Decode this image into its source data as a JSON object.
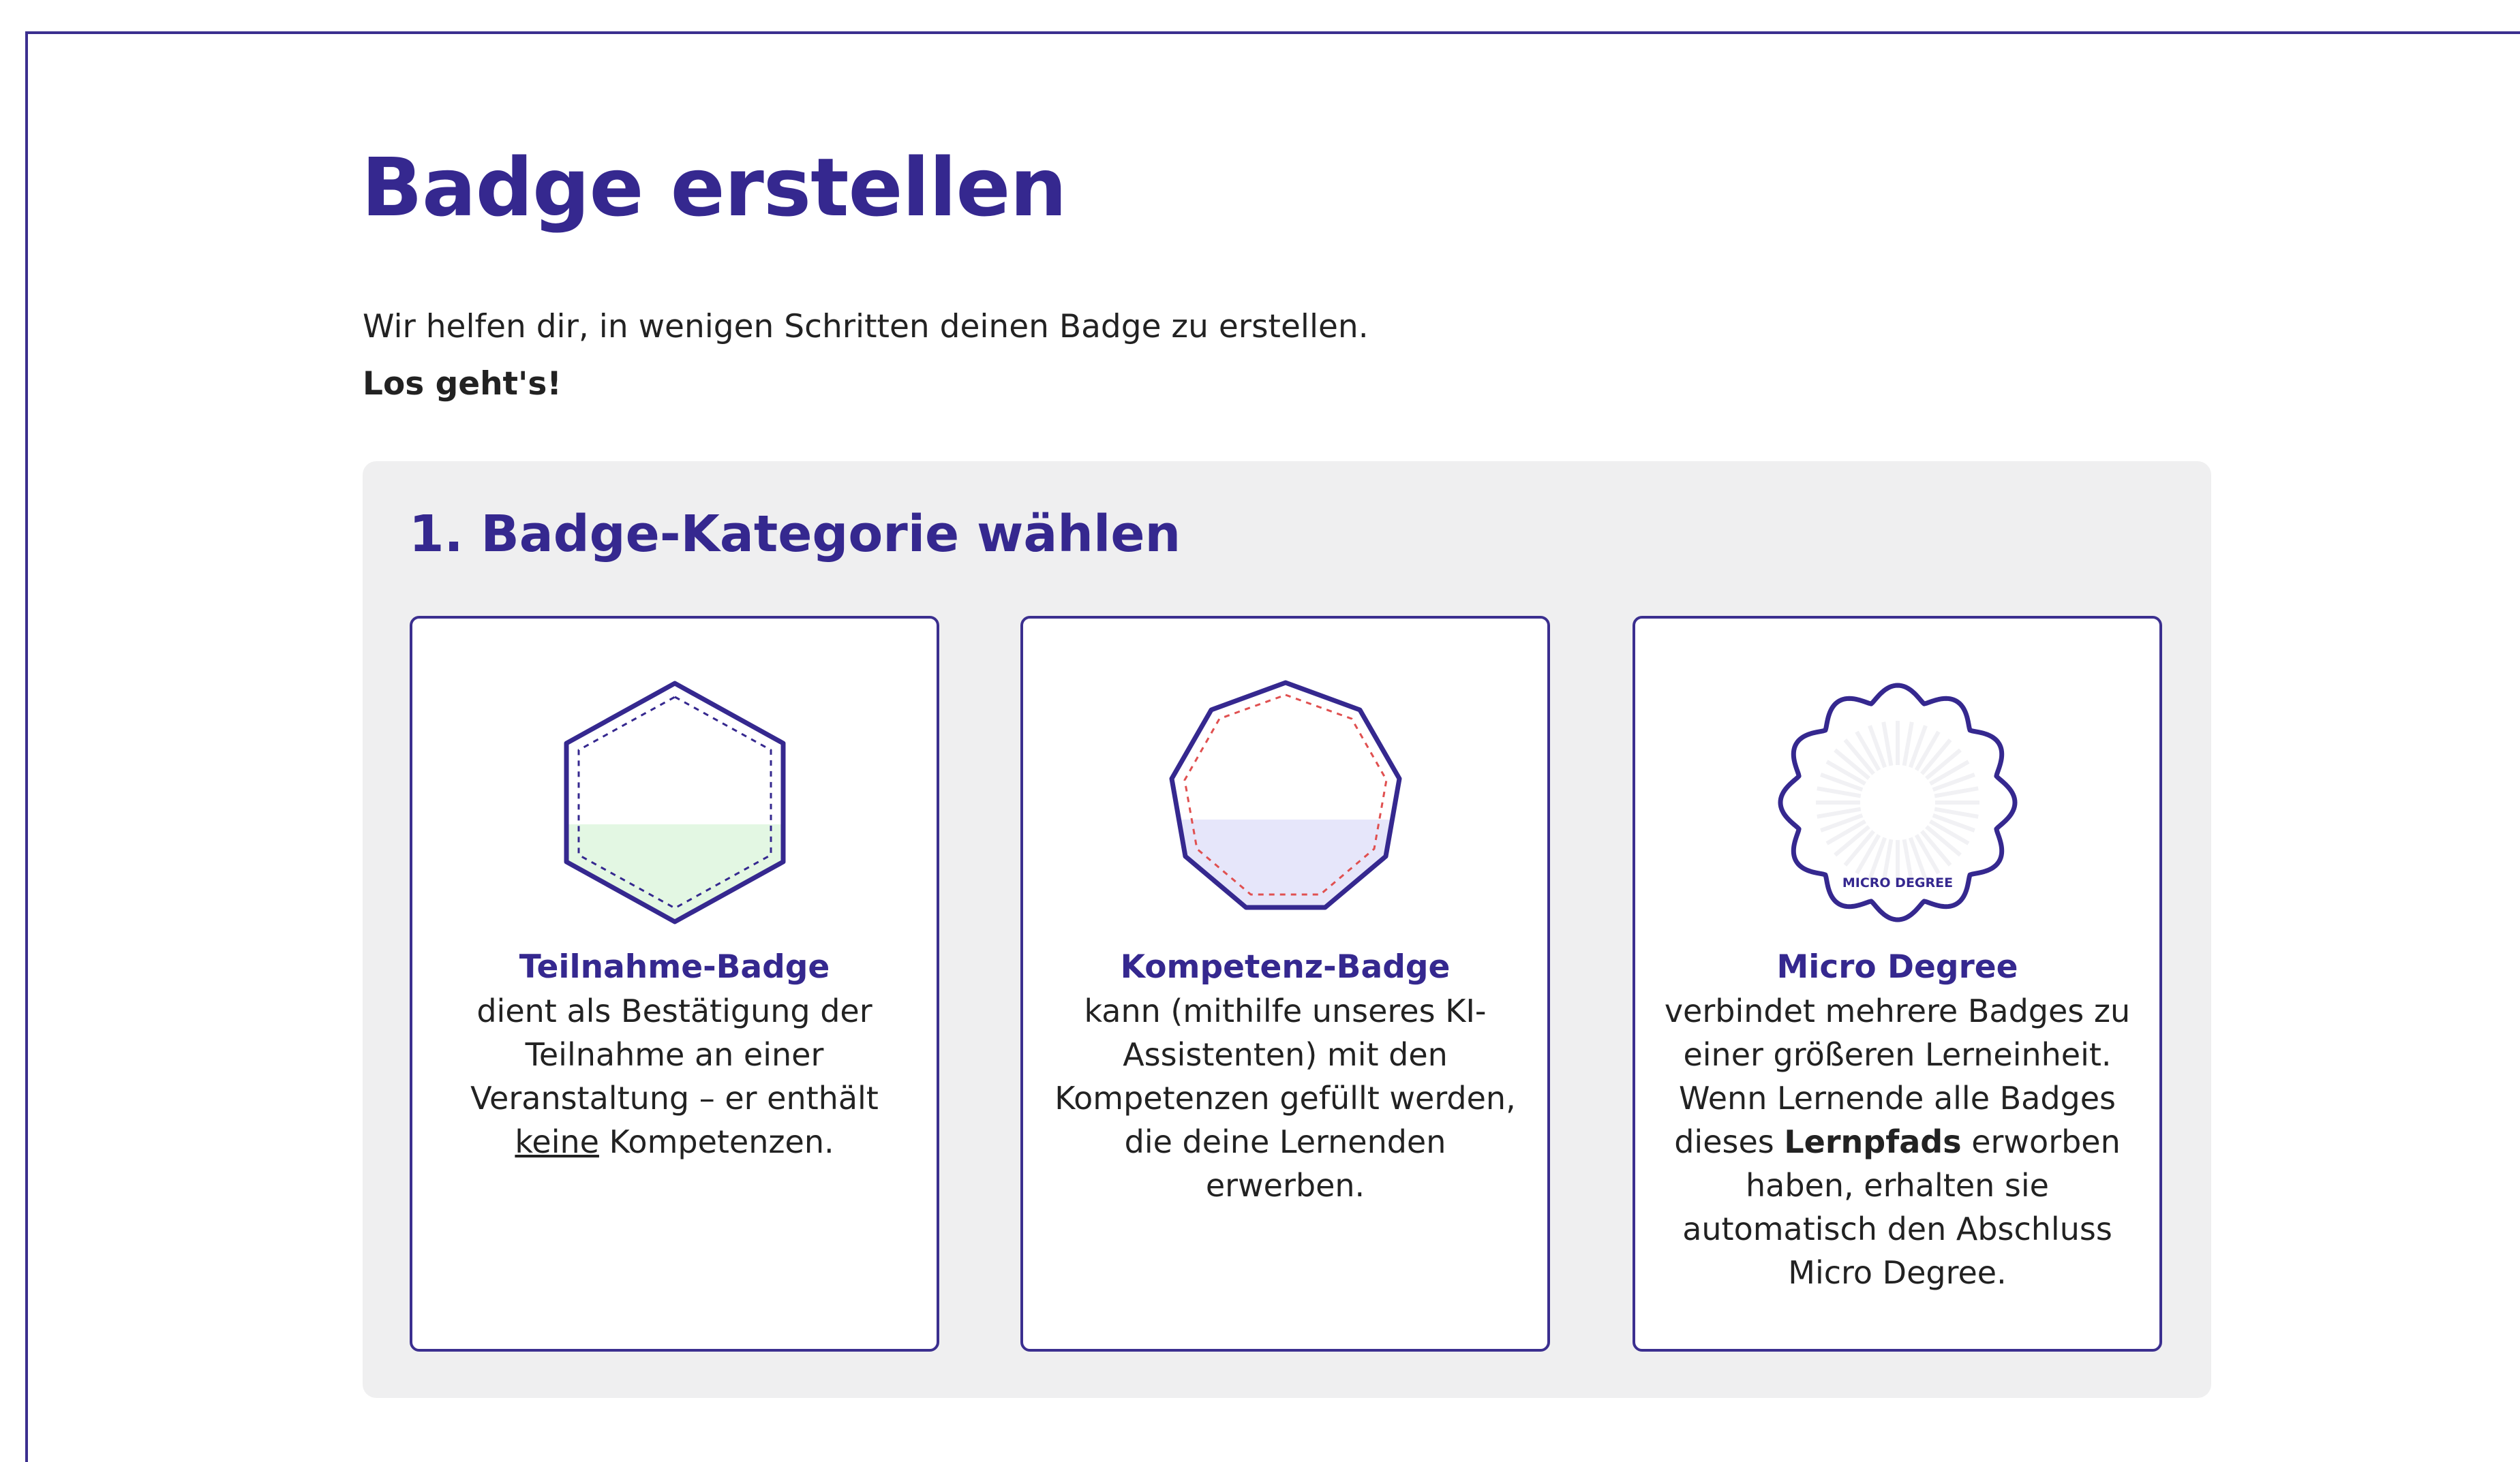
{
  "header": {
    "title": "Badge erstellen",
    "intro": "Wir helfen dir, in wenigen Schritten deinen Badge zu erstellen.",
    "intro_strong": "Los geht's!"
  },
  "section": {
    "title": "1. Badge-Kategorie wählen"
  },
  "cards": [
    {
      "title": "Teilnahme-Badge",
      "icon": "hexagon-badge-icon",
      "desc_before": "dient als Bestätigung der Teilnahme an einer Veranstaltung – er enthält",
      "desc_underline": "keine",
      "desc_after": "Kompetenzen."
    },
    {
      "title": "Kompetenz-Badge",
      "icon": "nonagon-badge-icon",
      "desc": "kann (mithilfe unseres KI-Assistenten) mit den Kompetenzen gefüllt werden, die deine Lernenden erwerben."
    },
    {
      "title": "Micro Degree",
      "icon": "rosette-badge-icon",
      "badge_label": "MICRO DEGREE",
      "desc_before": "verbindet mehrere Badges zu einer größeren Lerneinheit. Wenn Lernende alle Badges dieses",
      "desc_bold": "Lernpfads",
      "desc_after": "erworben haben, erhalten sie automatisch den Abschluss Micro Degree."
    }
  ],
  "colors": {
    "primary": "#35288f",
    "panel_bg": "#efeff0",
    "participation_fill": "#e3f7e3",
    "competency_fill": "#e6e6fa",
    "competency_dash": "#e05050"
  }
}
